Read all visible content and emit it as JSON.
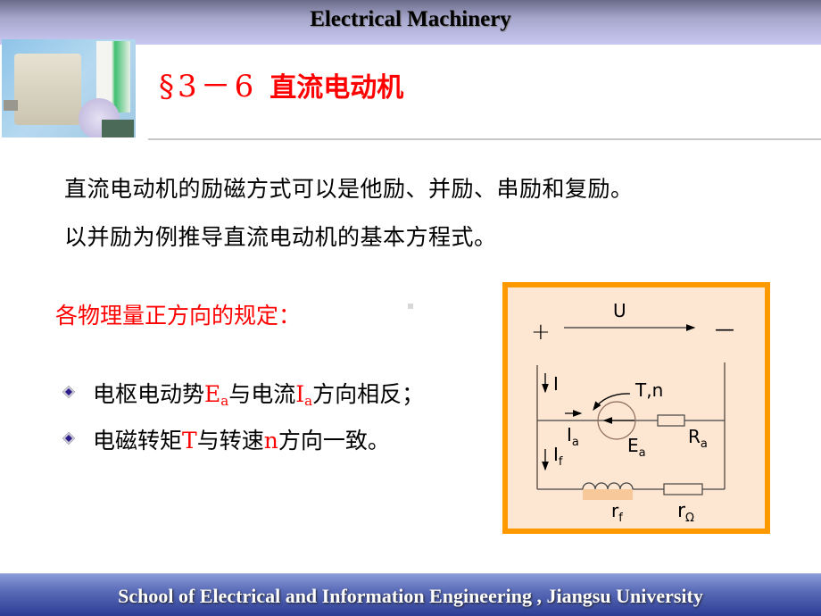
{
  "header": {
    "title": "Electrical Machinery"
  },
  "section": {
    "number": "§3－6",
    "name": "直流电动机"
  },
  "intro": {
    "line1": "直流电动机的励磁方式可以是他励、并励、串励和复励。",
    "line2": "以并励为例推导直流电动机的基本方程式。"
  },
  "rules": {
    "heading": "各物理量正方向的规定：",
    "bullets": [
      {
        "pre": "电枢电动势",
        "sym1": "E",
        "sub1": "a",
        "mid": "与电流",
        "sym2": "I",
        "sub2": "a",
        "post": "方向相反；"
      },
      {
        "pre": "电磁转矩",
        "sym1": "T",
        "mid": "与转速",
        "sym2": "n",
        "post": "方向一致。"
      }
    ]
  },
  "circuit": {
    "voltage_label": "U",
    "plus": "+",
    "minus": "—",
    "current_I": "I",
    "torque_speed": "T,n",
    "armature_current": "I",
    "armature_current_sub": "a",
    "emf": "E",
    "emf_sub": "a",
    "armature_resistance": "R",
    "armature_resistance_sub": "a",
    "field_current": "I",
    "field_current_sub": "f",
    "field_resistance": "r",
    "field_resistance_sub": "f",
    "rheostat": "r",
    "rheostat_sub": "Ω"
  },
  "footer": {
    "text": "School of Electrical and Information Engineering , Jiangsu University"
  },
  "colors": {
    "accent_red": "#ff0000",
    "box_border": "#ff9900",
    "box_fill": "#fde6d2",
    "footer_blue": "#2c3c94"
  }
}
